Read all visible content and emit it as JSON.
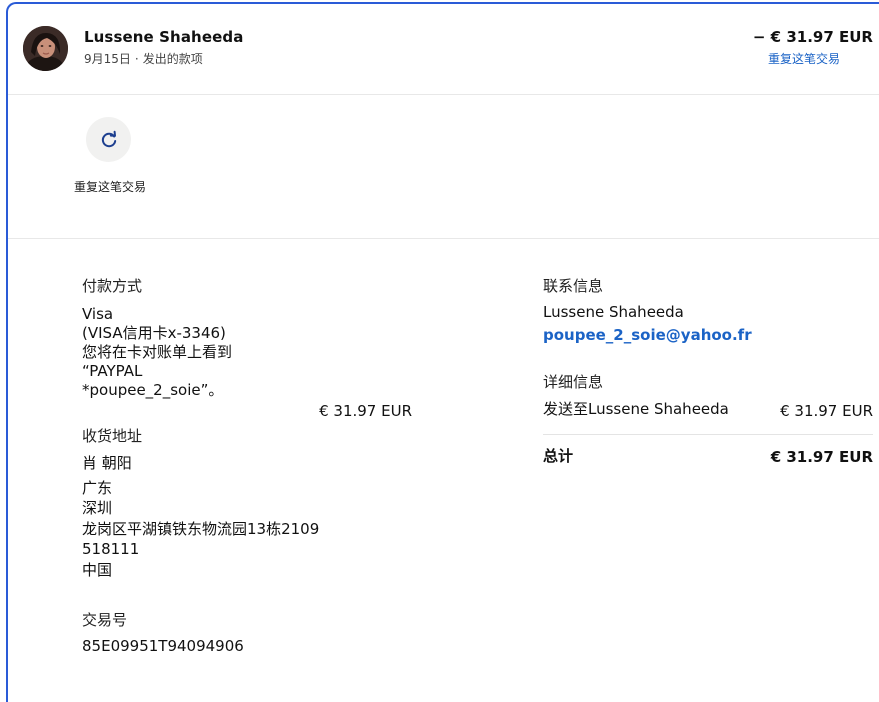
{
  "header": {
    "name": "Lussene Shaheeda",
    "date": "9月15日",
    "separator": "·",
    "type": "发出的款项",
    "amount": "− € 31.97 EUR",
    "repeat_link": "重复这笔交易"
  },
  "action": {
    "icon": "refresh-icon",
    "label": "重复这笔交易"
  },
  "payment": {
    "label": "付款方式",
    "method": "Visa",
    "card": "(VISA信用卡x-3346)",
    "note_line1": "您将在卡对账单上看到",
    "note_line2": "“PAYPAL",
    "note_line3": "*poupee_2_soie”。",
    "amount": "€ 31.97 EUR"
  },
  "shipping": {
    "label": "收货地址",
    "name": "肖 朝阳",
    "province": "广东",
    "city": "深圳",
    "street": "龙岗区平湖镇铁东物流园13栋2109",
    "postcode": "518111",
    "country": "中国"
  },
  "transaction": {
    "label": "交易号",
    "id": "85E09951T94094906"
  },
  "contact": {
    "label": "联系信息",
    "name": "Lussene Shaheeda",
    "email": "poupee_2_soie@yahoo.fr"
  },
  "details": {
    "label": "详细信息",
    "item": "发送至Lussene Shaheeda",
    "item_amount": "€ 31.97 EUR",
    "total_label": "总计",
    "total_amount": "€ 31.97 EUR"
  },
  "colors": {
    "accent": "#1b63c6",
    "frame": "#2a5bd7"
  }
}
